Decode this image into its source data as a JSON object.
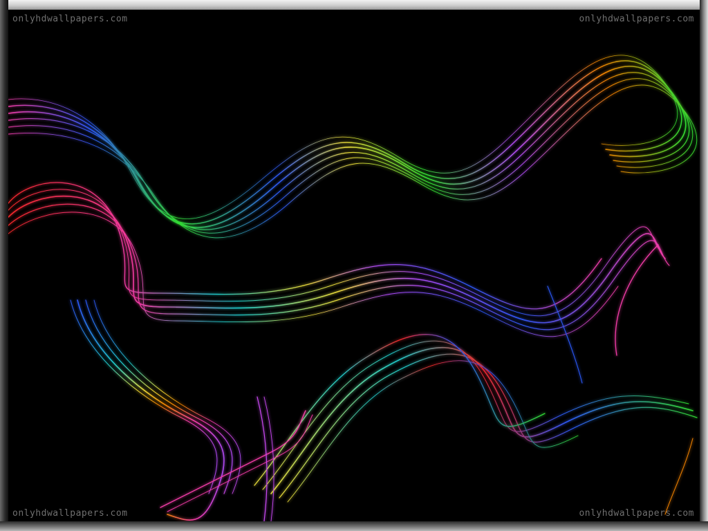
{
  "watermarks": {
    "top_left": "onlyhdwallpapers.com",
    "top_right": "onlyhdwallpapers.com",
    "bottom_left": "onlyhdwallpapers.com",
    "bottom_right": "onlyhdwallpapers.com"
  },
  "colors": {
    "background": "#000000",
    "frame_light": "#d0d0d0",
    "watermark": "#6f6f6f",
    "ribbons": [
      "#ff2a2a",
      "#ff8a00",
      "#f4e43a",
      "#35e835",
      "#1fd6d6",
      "#2f5bff",
      "#b84dff",
      "#ff3fb0"
    ]
  }
}
